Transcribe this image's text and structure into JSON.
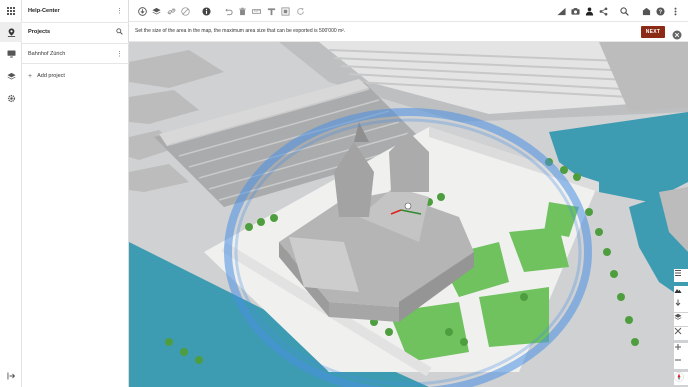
{
  "rail": {
    "items": [
      {
        "icon": "apps-grid-icon"
      },
      {
        "icon": "location-pin-icon"
      },
      {
        "icon": "monitor-icon"
      },
      {
        "icon": "layers-icon"
      },
      {
        "icon": "settings-icon"
      },
      {
        "icon": "collapse-sidebar-icon"
      }
    ]
  },
  "panel": {
    "header_title": "Help-Center",
    "projects_title": "Projects",
    "project_name": "Bahnhof Zürich",
    "add_project_label": "Add project"
  },
  "toolbar": {
    "left_icons": [
      "download-icon",
      "layers-icon",
      "link-icon",
      "eye-off-icon",
      "info-icon",
      "undo-icon",
      "trash-icon",
      "ruler-icon",
      "tool-icon",
      "frame-icon",
      "refresh-icon"
    ],
    "right_icons": [
      "slope-icon",
      "camera-icon",
      "person-icon",
      "share-icon",
      "search-icon",
      "globe-icon",
      "help-icon",
      "more-vertical-icon"
    ]
  },
  "instruction": {
    "text": "Set the size of the area in the map, the maximum area size that can be exported is 500'000 m².",
    "next_label": "NEXT",
    "accent_color": "#8b2b15"
  },
  "map_controls": [
    "list-icon",
    "terrain-icon",
    "download-arrow-icon",
    "layers-icon",
    "crosshair-icon",
    "zoom-in-icon",
    "zoom-out-icon",
    "compass-icon"
  ],
  "colors": {
    "water": "#3d9bb2",
    "grass": "#6fc25e",
    "selection_ring": "#4a90e2",
    "buildings": "#b9b9b9"
  }
}
